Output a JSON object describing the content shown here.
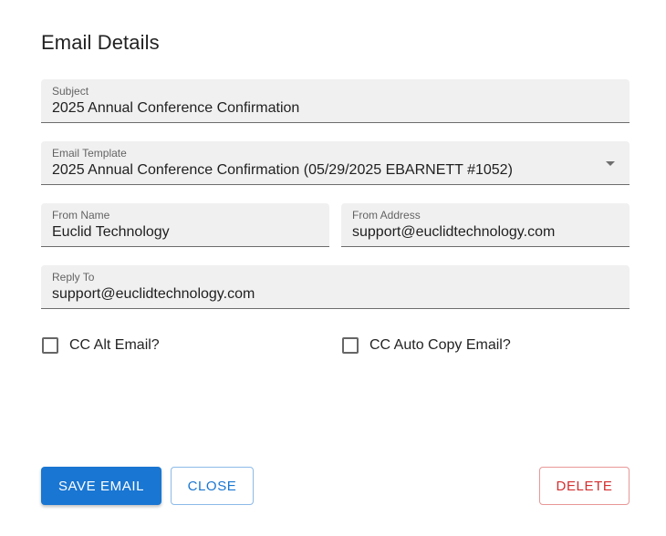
{
  "dialog": {
    "title": "Email Details"
  },
  "fields": {
    "subject": {
      "label": "Subject",
      "value": "2025 Annual Conference Confirmation"
    },
    "template": {
      "label": "Email Template",
      "value": "2025 Annual Conference Confirmation (05/29/2025 EBARNETT #1052)"
    },
    "from_name": {
      "label": "From Name",
      "value": "Euclid Technology"
    },
    "from_address": {
      "label": "From Address",
      "value": "support@euclidtechnology.com"
    },
    "reply_to": {
      "label": "Reply To",
      "value": "support@euclidtechnology.com"
    }
  },
  "checkboxes": {
    "cc_alt": {
      "label": "CC Alt Email?",
      "checked": false
    },
    "cc_auto": {
      "label": "CC Auto Copy Email?",
      "checked": false
    }
  },
  "buttons": {
    "save": "SAVE EMAIL",
    "close": "CLOSE",
    "delete": "DELETE"
  },
  "colors": {
    "primary": "#1976d2",
    "danger": "#d32f2f",
    "field_bg": "#f0f0f0"
  },
  "icons": {
    "template_dropdown": "chevron-down-icon",
    "checkbox": "checkbox-unchecked-icon"
  }
}
